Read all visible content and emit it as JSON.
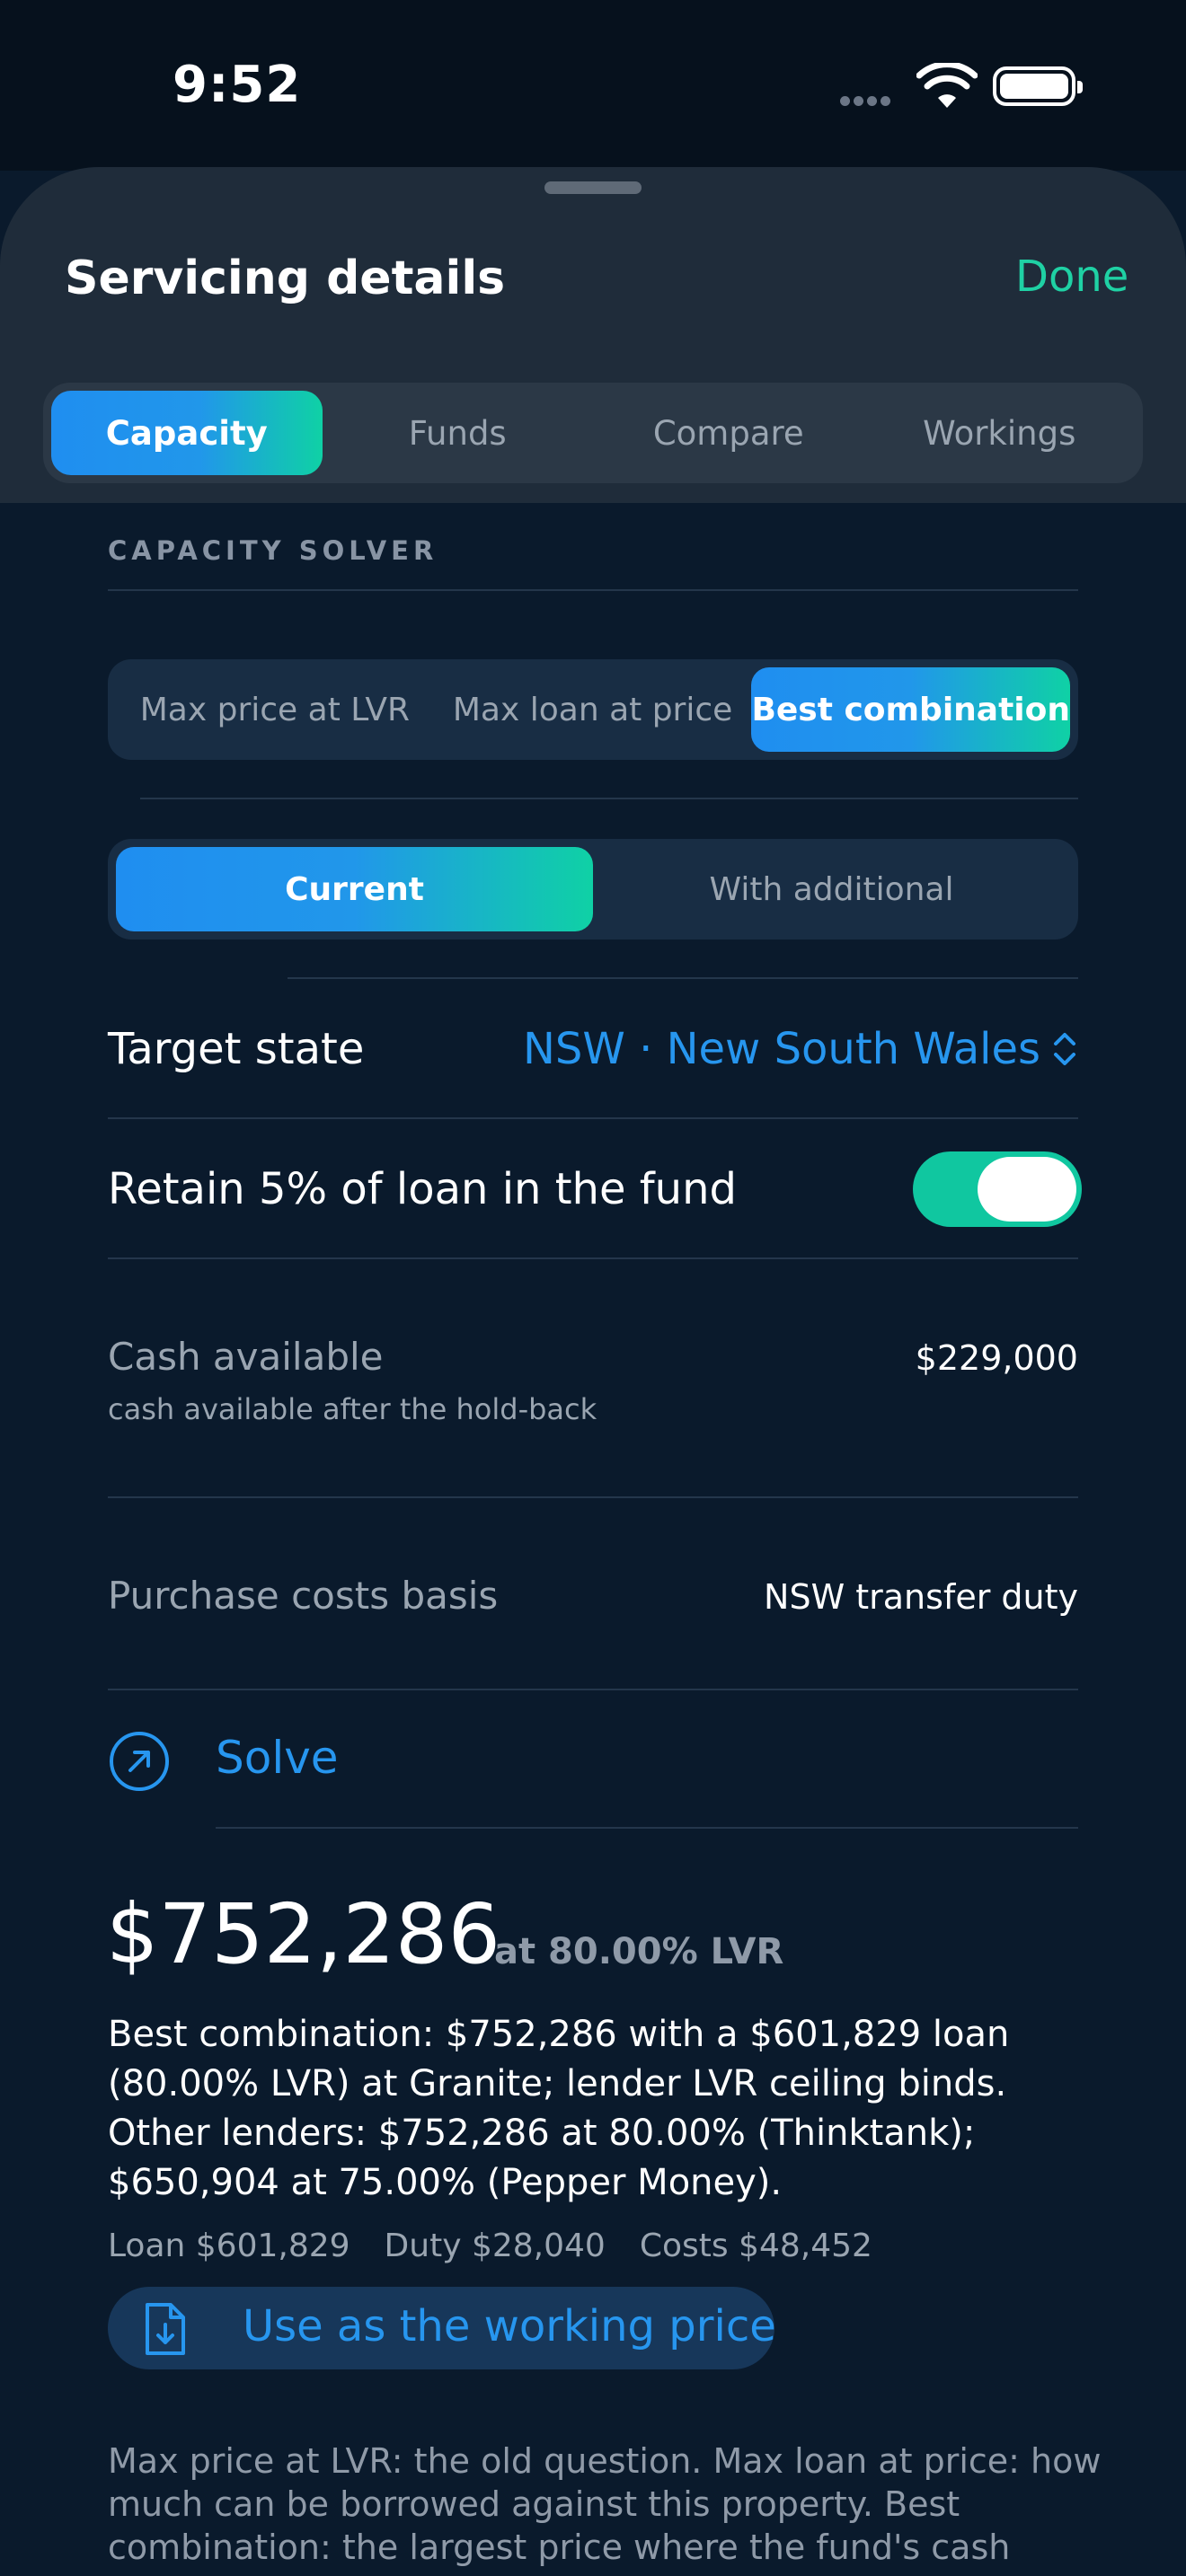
{
  "status_bar": {
    "time": "9:52"
  },
  "header": {
    "title": "Servicing details",
    "done_label": "Done"
  },
  "tabs": [
    {
      "label": "Capacity",
      "active": true
    },
    {
      "label": "Funds",
      "active": false
    },
    {
      "label": "Compare",
      "active": false
    },
    {
      "label": "Workings",
      "active": false
    }
  ],
  "section": {
    "label": "CAPACITY SOLVER"
  },
  "mode_segment": {
    "options": [
      "Max price at LVR",
      "Max loan at price",
      "Best combination"
    ],
    "selected": "Best combination"
  },
  "scenario_segment": {
    "options": [
      "Current",
      "With additional"
    ],
    "selected": "Current"
  },
  "target_state": {
    "label": "Target state",
    "value": "NSW · New South Wales"
  },
  "retain": {
    "label": "Retain 5% of loan in the fund",
    "enabled": true
  },
  "cash": {
    "label": "Cash available",
    "sublabel": "cash available after the hold-back",
    "value": "$229,000"
  },
  "purchase_costs": {
    "label": "Purchase costs basis",
    "value": "NSW transfer duty"
  },
  "solve": {
    "label": "Solve"
  },
  "result": {
    "amount": "$752,286",
    "lvr": "at 80.00% LVR",
    "description": "Best combination: $752,286 with a $601,829 loan (80.00% LVR) at Granite; lender LVR ceiling binds. Other lenders: $752,286 at 80.00% (Thinktank); $650,904 at 75.00% (Pepper Money).",
    "loan": "Loan $601,829",
    "duty": "Duty $28,040",
    "costs": "Costs $48,452"
  },
  "use_button": {
    "label": "Use as the working price"
  },
  "footnote": "Max price at LVR: the old question. Max loan at price: how much can be borrowed against this property. Best combination: the largest price where the fund's cash",
  "colors": {
    "accent_blue": "#2796ef",
    "accent_green": "#1fd1a4",
    "background": "#0a1a2c"
  },
  "icons": [
    "wifi-icon",
    "battery-icon",
    "chevron-updown-icon",
    "arrow-up-right-circle-icon",
    "document-download-icon"
  ]
}
